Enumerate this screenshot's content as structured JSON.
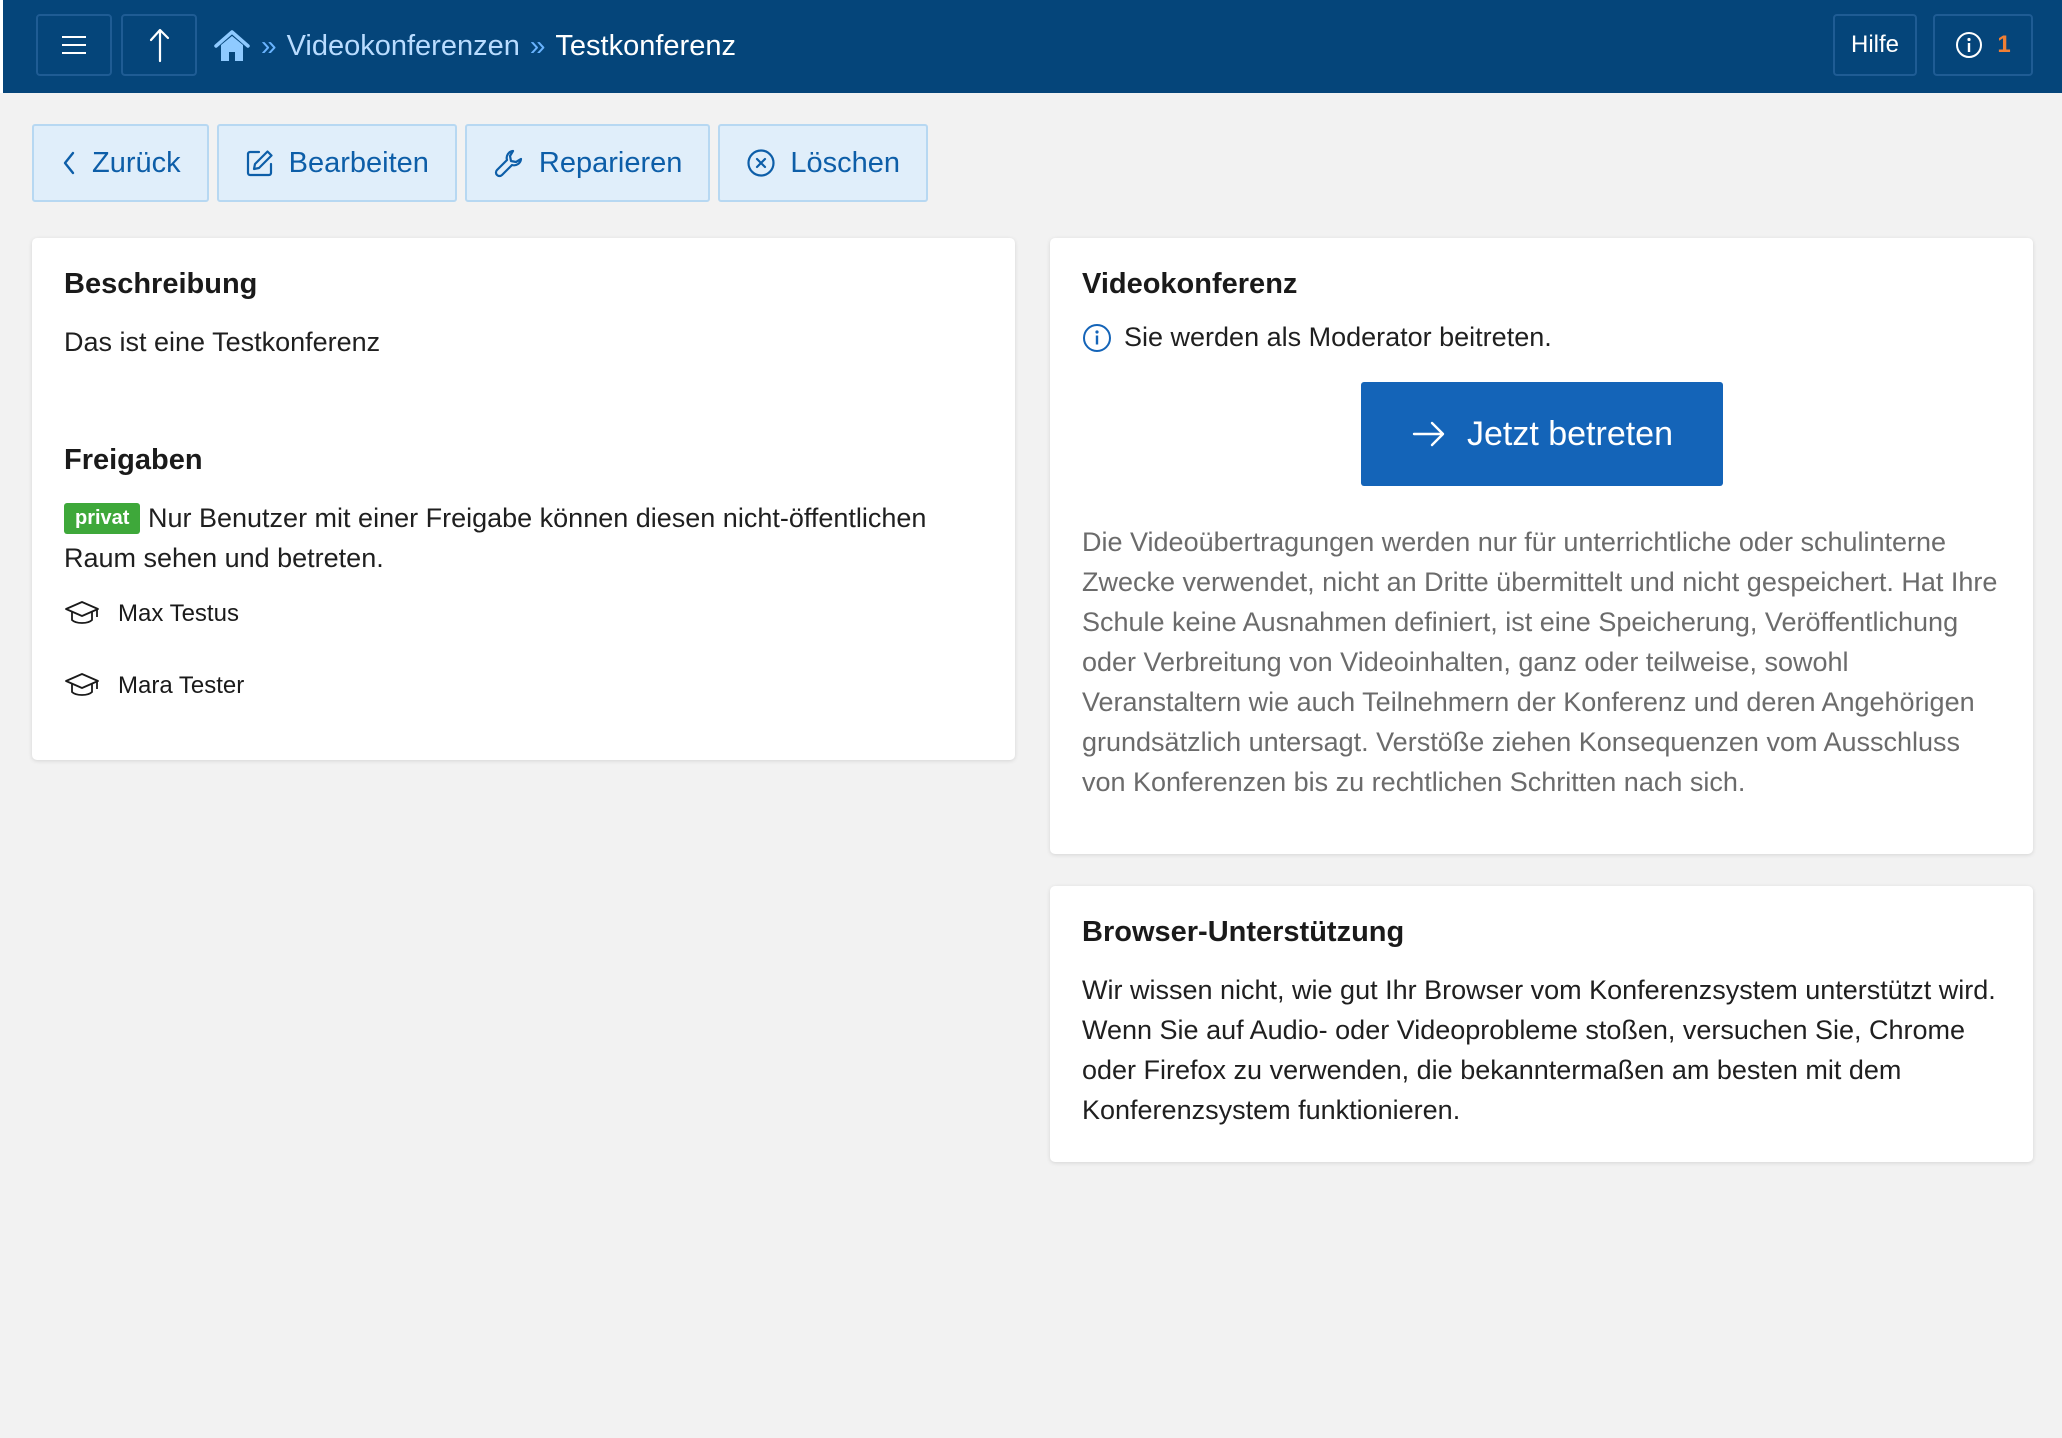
{
  "topbar": {
    "menu_icon": "hamburger-icon",
    "up_icon": "arrow-up-icon",
    "home_icon": "home-icon",
    "breadcrumb": {
      "separator": "»",
      "items": [
        {
          "label": "Videokonferenzen"
        },
        {
          "label": "Testkonferenz"
        }
      ]
    },
    "help_label": "Hilfe",
    "info_icon": "info-icon",
    "info_count": "1",
    "colors": {
      "bar": "#05457a",
      "breadcrumb_link": "#b9dcff",
      "separator": "#6ab4ff",
      "count": "#f07f34"
    }
  },
  "actions": [
    {
      "label": "Zurück",
      "icon": "chevron-left-icon"
    },
    {
      "label": "Bearbeiten",
      "icon": "edit-icon"
    },
    {
      "label": "Reparieren",
      "icon": "wrench-icon"
    },
    {
      "label": "Löschen",
      "icon": "close-circle-icon"
    }
  ],
  "description": {
    "title": "Beschreibung",
    "text": "Das ist eine Testkonferenz"
  },
  "shares": {
    "title": "Freigaben",
    "badge": "privat",
    "badge_color": "#3ea83a",
    "text": "Nur Benutzer mit einer Freigabe können diesen nicht-öffentlichen Raum sehen und betreten.",
    "users": [
      {
        "name": "Max Testus",
        "icon": "graduation-cap-icon"
      },
      {
        "name": "Mara Tester",
        "icon": "graduation-cap-icon"
      }
    ]
  },
  "video": {
    "title": "Videokonferenz",
    "info": "Sie werden als Moderator beitreten.",
    "join_label": "Jetzt betreten",
    "join_color": "#1464b8",
    "notice": "Die Videoübertragungen werden nur für unterrichtliche oder schulinterne Zwecke verwendet, nicht an Dritte übermittelt und nicht gespeichert. Hat Ihre Schule keine Ausnahmen definiert, ist eine Speicherung, Veröffentlichung oder Verbreitung von Videoinhalten, ganz oder teilweise, sowohl Veranstaltern wie auch Teilnehmern der Konferenz und deren Angehörigen grundsätzlich untersagt. Verstöße ziehen Konsequenzen vom Ausschluss von Konferenzen bis zu rechtlichen Schritten nach sich."
  },
  "browser": {
    "title": "Browser-Unterstützung",
    "text": "Wir wissen nicht, wie gut Ihr Browser vom Konferenzsystem unterstützt wird. Wenn Sie auf Audio- oder Videoprobleme stoßen, versuchen Sie, Chrome oder Firefox zu verwenden, die bekanntermaßen am besten mit dem Konferenzsystem funktionieren."
  }
}
